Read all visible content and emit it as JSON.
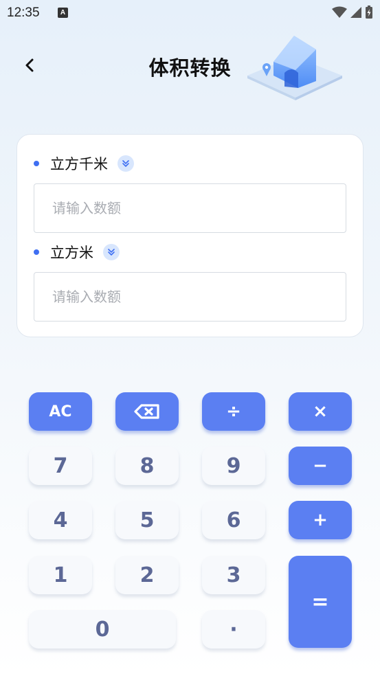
{
  "status_bar": {
    "time": "12:35",
    "notification_icon_letter": "A"
  },
  "header": {
    "title": "体积转换",
    "back_icon": "chevron-left-icon"
  },
  "converter": {
    "from_unit": {
      "label": "立方千米",
      "placeholder": "请输入数额",
      "value": ""
    },
    "to_unit": {
      "label": "立方米",
      "placeholder": "请输入数额",
      "value": ""
    }
  },
  "keypad": {
    "ac": "AC",
    "divide": "÷",
    "multiply": "×",
    "minus": "−",
    "plus": "+",
    "equals": "=",
    "digits": {
      "d7": "7",
      "d8": "8",
      "d9": "9",
      "d4": "4",
      "d5": "5",
      "d6": "6",
      "d1": "1",
      "d2": "2",
      "d3": "3",
      "d0": "0"
    },
    "dot": "·"
  },
  "colors": {
    "accent": "#5b7ff2",
    "dot": "#3f6ff2",
    "key_text": "#5c6896",
    "chevron_bg": "#d8e6fd"
  }
}
